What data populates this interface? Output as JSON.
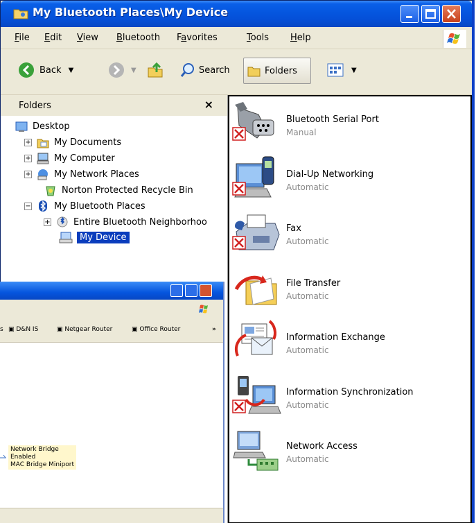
{
  "window": {
    "title": "My Bluetooth Places\\My Device"
  },
  "menu": [
    {
      "label": "File",
      "u": "F",
      "rest": "ile"
    },
    {
      "label": "Edit",
      "u": "E",
      "rest": "dit"
    },
    {
      "label": "View",
      "u": "V",
      "rest": "iew"
    },
    {
      "label": "Bluetooth",
      "u": "B",
      "rest": "luetooth"
    },
    {
      "label": "Favorites",
      "pre": "F",
      "u": "a",
      "rest": "vorites"
    },
    {
      "label": "Tools",
      "u": "T",
      "rest": "ools"
    },
    {
      "label": "Help",
      "u": "H",
      "rest": "elp"
    }
  ],
  "toolbar": {
    "back": "Back",
    "search": "Search",
    "folders": "Folders"
  },
  "folders": {
    "header": "Folders",
    "close": "×",
    "tree": [
      {
        "label": "Desktop"
      },
      {
        "label": "My Documents",
        "toggle": "+"
      },
      {
        "label": "My Computer",
        "toggle": "+"
      },
      {
        "label": "My Network Places",
        "toggle": "+"
      },
      {
        "label": "Norton Protected Recycle Bin"
      },
      {
        "label": "My Bluetooth Places",
        "toggle": "−"
      },
      {
        "label": "Entire Bluetooth Neighborhoo",
        "toggle": "+"
      },
      {
        "label": "My Device"
      }
    ]
  },
  "services": [
    {
      "name": "Bluetooth Serial Port",
      "status": "Manual",
      "icon": "serial-port-icon",
      "error": true
    },
    {
      "name": "Dial-Up Networking",
      "status": "Automatic",
      "icon": "dial-up-icon",
      "error": true
    },
    {
      "name": "Fax",
      "status": "Automatic",
      "icon": "fax-icon",
      "error": true
    },
    {
      "name": "File Transfer",
      "status": "Automatic",
      "icon": "file-transfer-icon",
      "error": false
    },
    {
      "name": "Information Exchange",
      "status": "Automatic",
      "icon": "information-exchange-icon",
      "error": false
    },
    {
      "name": "Information Synchronization",
      "status": "Automatic",
      "icon": "information-sync-icon",
      "error": true
    },
    {
      "name": "Network Access",
      "status": "Automatic",
      "icon": "network-access-icon",
      "error": false
    }
  ],
  "background_window": {
    "links": [
      "D&N IS",
      "Netgear Router",
      "Office Router"
    ],
    "chevron": "»",
    "item": {
      "name": "Network Bridge",
      "status": "Enabled",
      "detail": "MAC Bridge Miniport"
    }
  },
  "colors": {
    "title_blue": "#0556df",
    "selection": "#0a3dbd",
    "status_gray": "#8a8a8a",
    "error_red": "#d11f1f"
  }
}
